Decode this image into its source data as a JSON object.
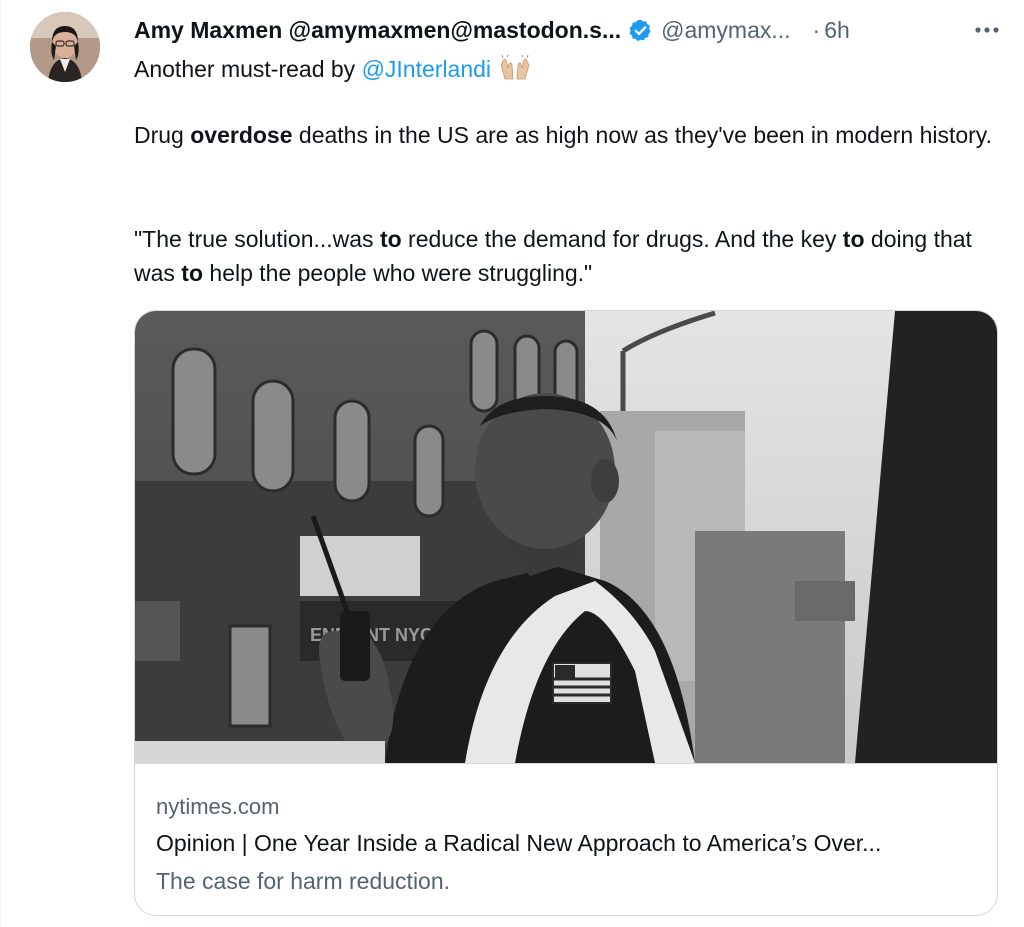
{
  "tweet": {
    "author": {
      "display_name": "Amy Maxmen @amymaxmen@mastodon.s...",
      "handle": "@amymax...",
      "verified": true
    },
    "separator": "·",
    "time": "6h",
    "line1": {
      "prefix": "Another must-read by ",
      "mention": "@JInterlandi",
      "emoji_icon": "raising-hands-emoji"
    },
    "para1": {
      "t1": "Drug ",
      "b1": "overdose",
      "t2": " deaths in the US are as high now as they've been in modern history."
    },
    "para2": {
      "t1": "\"The true solution...was ",
      "b1": "to",
      "t2": " reduce the demand for drugs. And the key ",
      "b2": "to",
      "t3": " doing that was ",
      "b3": "to",
      "t4": " help the people who were struggling.\""
    }
  },
  "link_card": {
    "domain": "nytimes.com",
    "title": "Opinion | One Year Inside a Radical New Approach to America’s Over...",
    "description": "The case for harm reduction.",
    "image_icon": "news-photo-man-with-radio",
    "image_sign_text": "ENPOINT NYC"
  },
  "colors": {
    "accent": "#1d9bf0",
    "text": "#0f1419",
    "muted": "#536471",
    "border": "#cfd9de"
  }
}
